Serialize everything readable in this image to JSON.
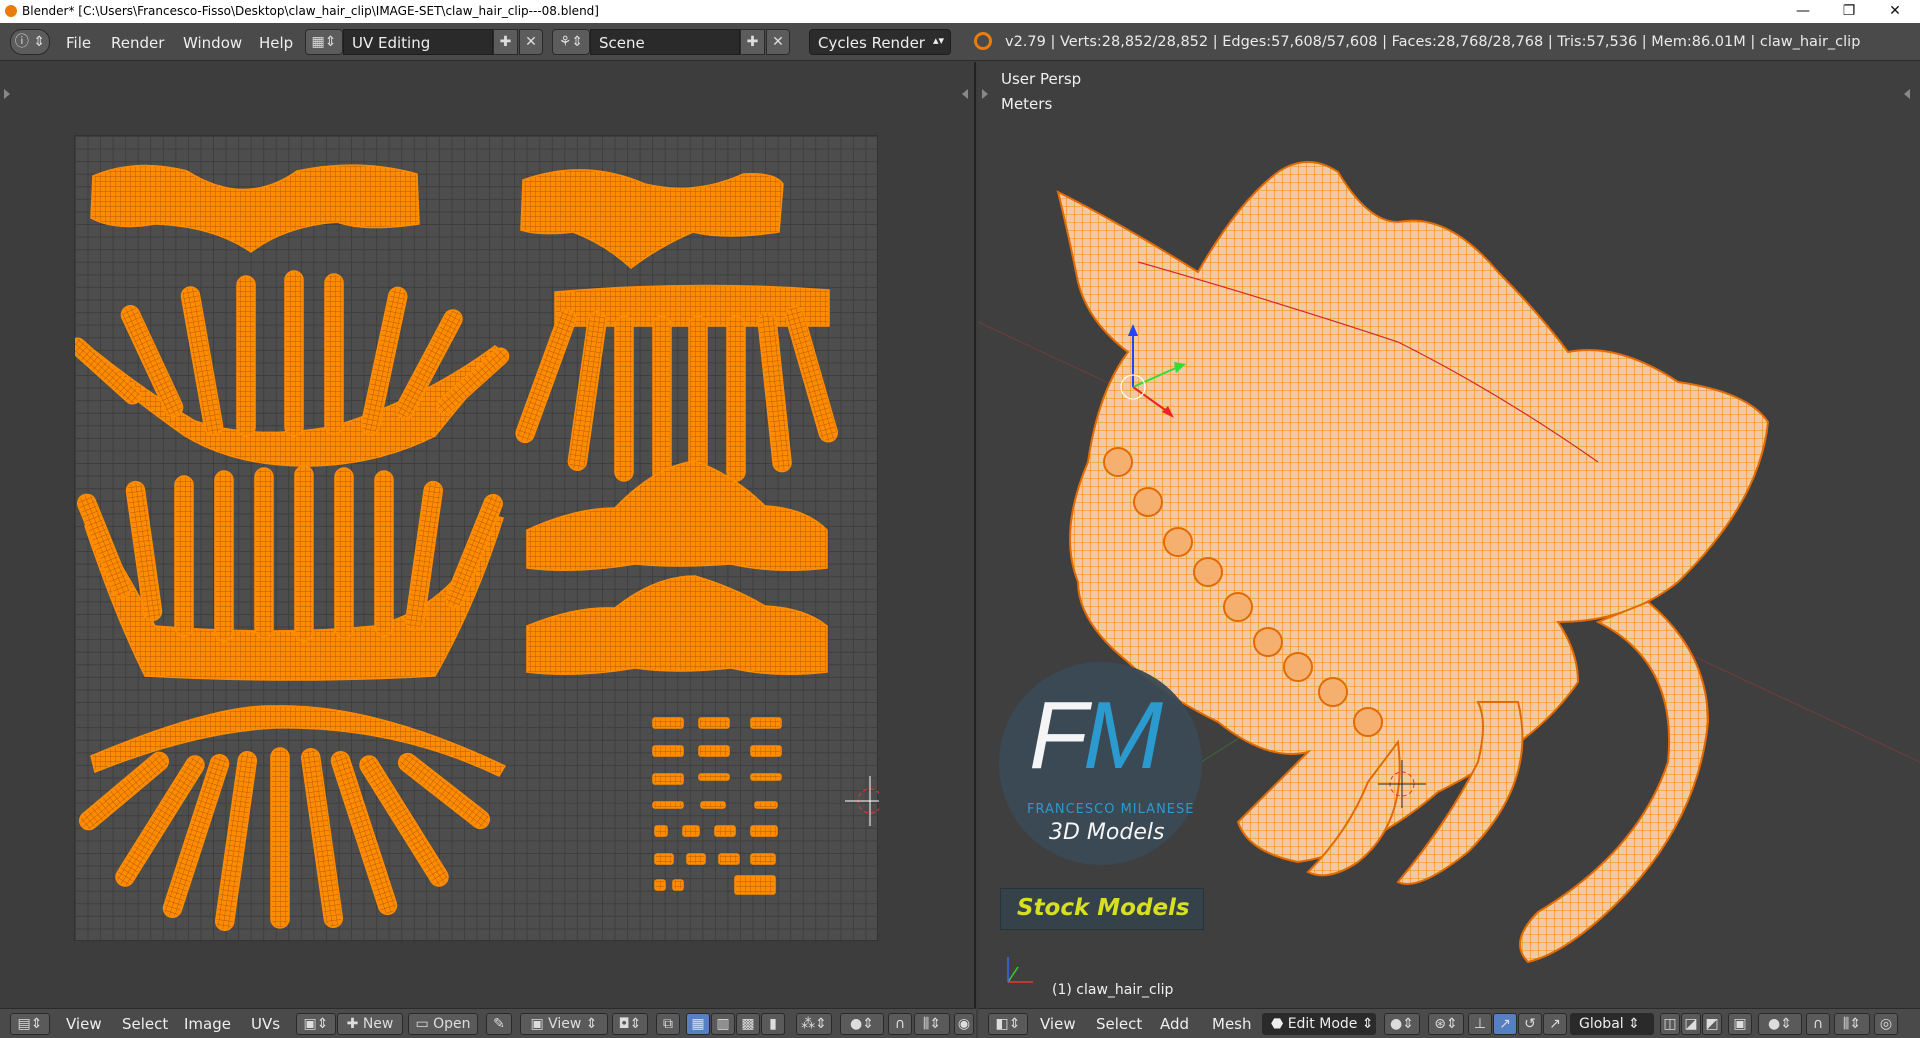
{
  "window": {
    "title": "Blender* [C:\\Users\\Francesco-Fisso\\Desktop\\claw_hair_clip\\IMAGE-SET\\claw_hair_clip---08.blend]",
    "minimize": "—",
    "maximize": "❐",
    "close": "✕"
  },
  "info_header": {
    "menus": [
      "File",
      "Render",
      "Window",
      "Help"
    ],
    "screen_layout": "UV Editing",
    "scene": "Scene",
    "render_engine": "Cycles Render",
    "stats": "v2.79 | Verts:28,852/28,852 | Edges:57,608/57,608 | Faces:28,768/28,768 | Tris:57,536 | Mem:86.01M | claw_hair_clip"
  },
  "viewport": {
    "view_name": "User Persp",
    "units": "Meters",
    "object_label": "(1) claw_hair_clip"
  },
  "watermark": {
    "logo_letters_f": "F",
    "logo_letters_m": "M",
    "brand": "FRANCESCO MILANESE",
    "subtitle": "3D Models",
    "banner": "Stock Models"
  },
  "uv_header": {
    "menus": [
      "View",
      "Select",
      "Image",
      "UVs"
    ],
    "new_label": "New",
    "open_label": "Open",
    "view_label": "View"
  },
  "view3d_header": {
    "menus": [
      "View",
      "Select",
      "Add",
      "Mesh"
    ],
    "mode": "Edit Mode",
    "orientation": "Global"
  },
  "colors": {
    "accent": "#ff8c00",
    "wire": "#e46a00",
    "selected_blue": "#5680c2"
  }
}
